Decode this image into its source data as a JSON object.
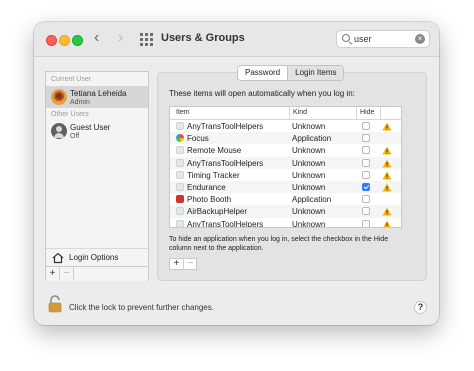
{
  "window": {
    "title": "Users & Groups",
    "search": {
      "value": "user",
      "placeholder": "Search"
    }
  },
  "sidebar": {
    "current_user_header": "Current User",
    "other_users_header": "Other Users",
    "current_user": {
      "name": "Tetiana Leheida",
      "role": "Admin"
    },
    "other_users": [
      {
        "name": "Guest User",
        "status": "Off"
      }
    ],
    "login_options_label": "Login Options",
    "add_label": "+",
    "remove_label": "−"
  },
  "tabs": [
    {
      "label": "Password",
      "active": false
    },
    {
      "label": "Login Items",
      "active": true
    }
  ],
  "login_items": {
    "intro": "These items will open automatically when you log in:",
    "columns": {
      "item": "Item",
      "kind": "Kind",
      "hide": "Hide"
    },
    "rows": [
      {
        "name": "AnyTransToolHelpers",
        "kind": "Unknown",
        "hide": false,
        "warning": true,
        "icon": "generic-app-icon"
      },
      {
        "name": "Focus",
        "kind": "Application",
        "hide": false,
        "warning": false,
        "icon": "focus-app-icon"
      },
      {
        "name": "Remote Mouse",
        "kind": "Unknown",
        "hide": false,
        "warning": true,
        "icon": "generic-app-icon"
      },
      {
        "name": "AnyTransToolHelpers",
        "kind": "Unknown",
        "hide": false,
        "warning": true,
        "icon": "generic-app-icon"
      },
      {
        "name": "Timing Tracker",
        "kind": "Unknown",
        "hide": false,
        "warning": true,
        "icon": "generic-app-icon"
      },
      {
        "name": "Endurance",
        "kind": "Unknown",
        "hide": true,
        "warning": true,
        "icon": "generic-app-icon"
      },
      {
        "name": "Photo Booth",
        "kind": "Application",
        "hide": false,
        "warning": false,
        "icon": "photo-booth-app-icon"
      },
      {
        "name": "AirBackupHelper",
        "kind": "Unknown",
        "hide": false,
        "warning": true,
        "icon": "generic-app-icon"
      },
      {
        "name": "AnyTransToolHelpers",
        "kind": "Unknown",
        "hide": false,
        "warning": true,
        "icon": "generic-app-icon"
      }
    ],
    "hint": "To hide an application when you log in, select the checkbox in the Hide column next to the application.",
    "add_label": "+",
    "remove_label": "−"
  },
  "footer": {
    "lock_text": "Click the lock to prevent further changes.",
    "help_label": "?"
  },
  "colors": {
    "accent": "#2f7cf6",
    "warning": "#f5b400",
    "selected_row": "#d6d6d6"
  }
}
